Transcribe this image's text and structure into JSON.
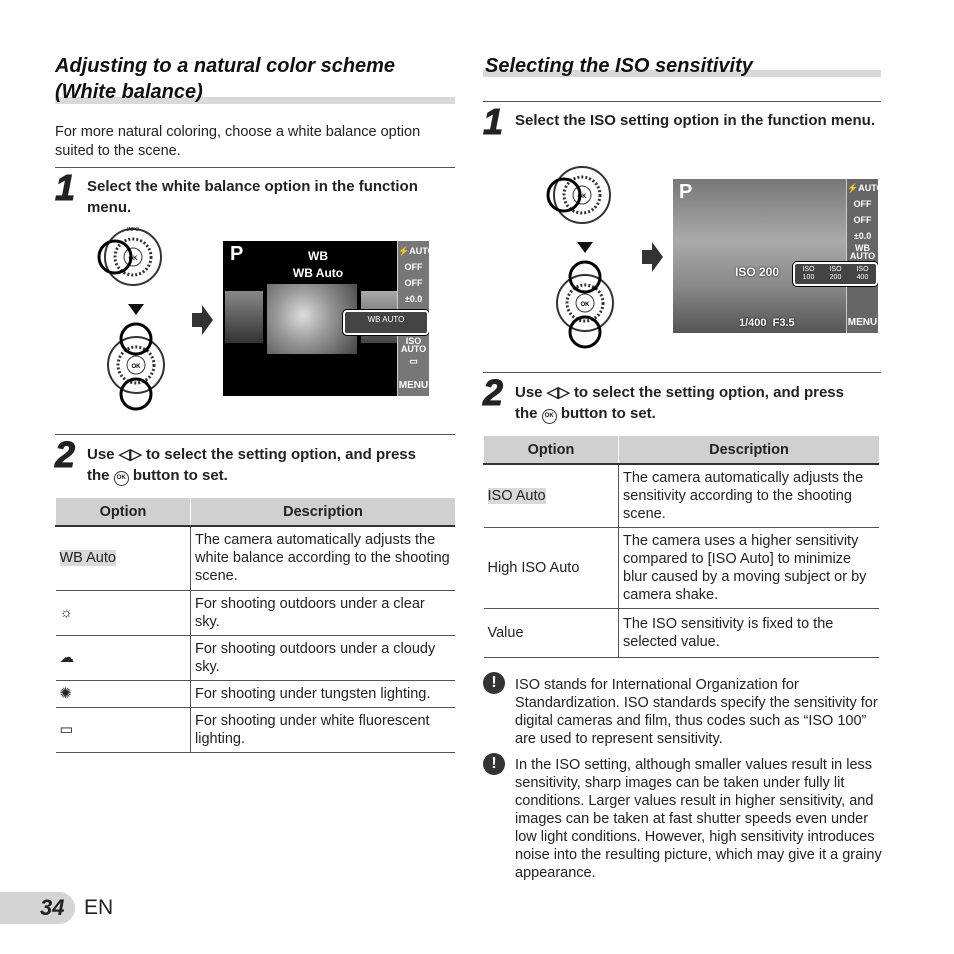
{
  "left": {
    "title_line1": "Adjusting to a natural color scheme",
    "title_line2": "(White balance)",
    "intro": "For more natural coloring, choose a white balance option suited to the scene.",
    "step1_num": "1",
    "step1_text": "Select the white balance option in the function menu.",
    "screen": {
      "mode": "P",
      "label1": "WB",
      "label2": "WB Auto",
      "sidebar": [
        "⚡AUTO",
        "OFF",
        "OFF",
        "±0.0",
        "ISO AUTO",
        "▭",
        "MENU"
      ],
      "options": [
        "WB AUTO"
      ]
    },
    "step2_num": "2",
    "step2_pre": "Use",
    "step2_mid": "to select the setting option, and press the",
    "step2_post": "button to set.",
    "ok_label": "OK",
    "table": {
      "headers": [
        "Option",
        "Description"
      ],
      "rows": [
        {
          "option": "WB Auto",
          "icon": "",
          "desc": "The camera automatically adjusts the white balance according to the shooting scene."
        },
        {
          "option": "",
          "icon": "sun-icon",
          "desc": "For shooting outdoors under a clear sky."
        },
        {
          "option": "",
          "icon": "cloud-icon",
          "desc": "For shooting outdoors under a cloudy sky."
        },
        {
          "option": "",
          "icon": "tungsten-icon",
          "desc": "For shooting under tungsten lighting."
        },
        {
          "option": "",
          "icon": "fluorescent-icon",
          "desc": "For shooting under white fluorescent lighting."
        }
      ]
    }
  },
  "right": {
    "title": "Selecting the ISO sensitivity",
    "step1_num": "1",
    "step1_text": "Select the ISO setting option in the function menu.",
    "screen": {
      "mode": "P",
      "iso_label": "ISO 200",
      "options": [
        "ISO 100",
        "ISO 200",
        "ISO 400"
      ],
      "shutter": "1/400",
      "aperture": "F3.5",
      "sidebar": [
        "⚡AUTO",
        "OFF",
        "OFF",
        "±0.0",
        "WB AUTO",
        "",
        "▭",
        "MENU"
      ]
    },
    "step2_num": "2",
    "step2_pre": "Use",
    "step2_mid": "to select the setting option, and press the",
    "step2_post": "button to set.",
    "table": {
      "headers": [
        "Option",
        "Description"
      ],
      "rows": [
        {
          "option": "ISO Auto",
          "desc": "The camera automatically adjusts the sensitivity according to the shooting scene."
        },
        {
          "option": "High ISO Auto",
          "desc": "The camera uses a higher sensitivity compared to [ISO Auto] to minimize blur caused by a moving subject or by camera shake."
        },
        {
          "option": "Value",
          "desc": "The ISO sensitivity is fixed to the selected value."
        }
      ]
    },
    "notes": [
      "ISO stands for International Organization for Standardization. ISO standards specify the sensitivity for digital cameras and film, thus codes such as “ISO 100” are used to represent sensitivity.",
      "In the ISO setting, although smaller values result in less sensitivity, sharp images can be taken under fully lit conditions. Larger values result in higher sensitivity, and images can be taken at fast shutter speeds even under low light conditions. However, high sensitivity introduces noise into the resulting picture, which may give it a grainy appearance."
    ],
    "note_icon": "!"
  },
  "footer": {
    "page": "34",
    "lang": "EN"
  },
  "dial": {
    "top_label": "INFO",
    "center_label": "OK"
  }
}
